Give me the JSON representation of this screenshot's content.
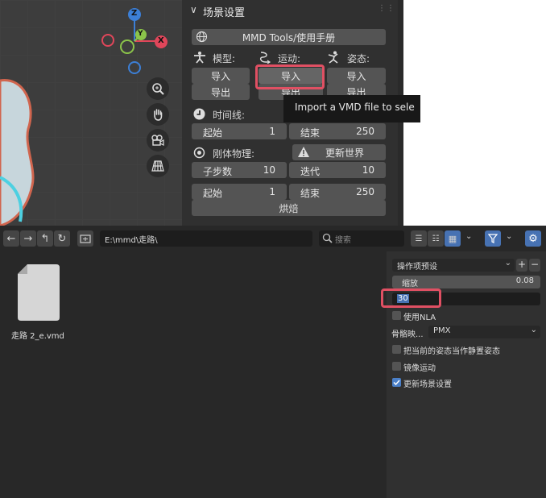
{
  "viewport": {
    "axes": {
      "z": "Z",
      "y": "Y",
      "x": "X"
    }
  },
  "panel": {
    "section_title": "场景设置",
    "manual_button": "MMD Tools/使用手册",
    "model_label": "模型:",
    "motion_label": "运动:",
    "pose_label": "姿态:",
    "import_label": "导入",
    "export_label": "导出",
    "timeline_label": "时间线:",
    "start_label": "起始",
    "start_value": "1",
    "end_label": "结束",
    "end_value": "250",
    "rigid_label": "刚体物理:",
    "update_world": "更新世界",
    "substeps_label": "子步数",
    "substeps_value": "10",
    "iterations_label": "迭代",
    "iterations_value": "10",
    "cache_start_value": "1",
    "cache_end_value": "250",
    "bake_label": "烘焙"
  },
  "tooltip": "Import a VMD file to sele",
  "filebrowser": {
    "path": "E:\\mmd\\走路\\",
    "search_placeholder": "搜索",
    "file_name": "走路 2_e.vmd"
  },
  "operator": {
    "preset_label": "操作项预设",
    "scale_label": "缩放",
    "scale_value": "0.08",
    "margin_value": "30",
    "use_nla_label": "使用NLA",
    "bone_mapper_label": "骨骼映...",
    "bone_mapper_value": "PMX",
    "use_pose_label": "把当前的姿态当作静置姿态",
    "mirror_label": "镜像运动",
    "update_scene_label": "更新场景设置"
  },
  "colors": {
    "accent": "#4772b3",
    "highlight": "#e05063",
    "axis_x": "#e0465a",
    "axis_y": "#8bc34a",
    "axis_z": "#3c7fd6"
  }
}
